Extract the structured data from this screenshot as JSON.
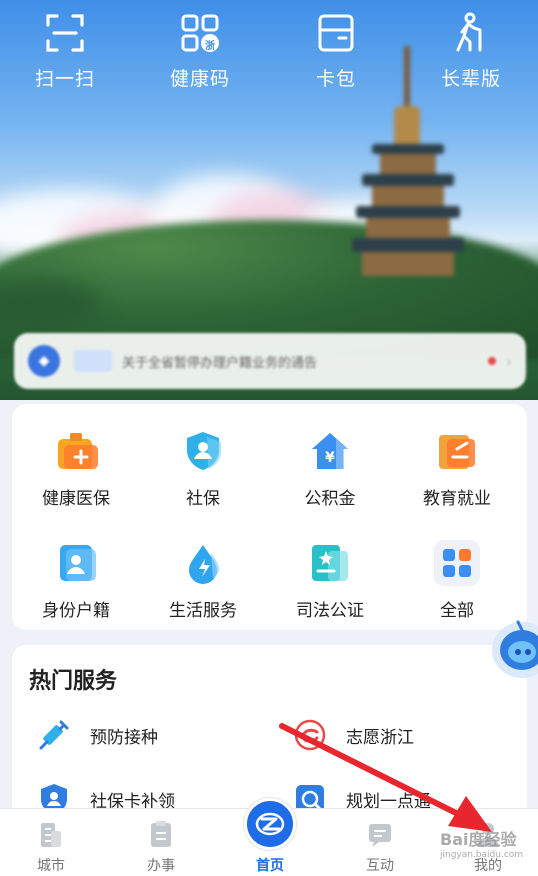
{
  "top_actions": [
    {
      "label": "扫一扫",
      "icon": "scan-icon"
    },
    {
      "label": "健康码",
      "icon": "health-code-icon",
      "badge": "浙"
    },
    {
      "label": "卡包",
      "icon": "card-wallet-icon"
    },
    {
      "label": "长辈版",
      "icon": "elder-mode-icon"
    }
  ],
  "notice": {
    "text": "关于全省暂停办理户籍业务的通告"
  },
  "services_grid": [
    {
      "label": "健康医保",
      "icon": "medical-kit-icon"
    },
    {
      "label": "社保",
      "icon": "social-security-icon"
    },
    {
      "label": "公积金",
      "icon": "housing-fund-icon"
    },
    {
      "label": "教育就业",
      "icon": "education-icon"
    },
    {
      "label": "身份户籍",
      "icon": "id-card-icon"
    },
    {
      "label": "生活服务",
      "icon": "water-drop-icon"
    },
    {
      "label": "司法公证",
      "icon": "notary-icon"
    },
    {
      "label": "全部",
      "icon": "all-apps-icon"
    }
  ],
  "hot_services": {
    "title": "热门服务",
    "items": [
      {
        "label": "预防接种",
        "icon": "syringe-icon"
      },
      {
        "label": "志愿浙江",
        "icon": "volunteer-icon"
      },
      {
        "label": "社保卡补领",
        "icon": "card-reissue-icon"
      },
      {
        "label": "规划一点通",
        "icon": "planning-icon"
      }
    ]
  },
  "bottom_nav": [
    {
      "label": "城市",
      "icon": "city-icon"
    },
    {
      "label": "办事",
      "icon": "tasks-icon"
    },
    {
      "label": "首页",
      "icon": "home-logo-icon",
      "active": true
    },
    {
      "label": "互动",
      "icon": "chat-icon"
    },
    {
      "label": "我的",
      "icon": "profile-icon"
    }
  ],
  "watermark": {
    "text": "Bai度经验",
    "sub": "jingyan.baidu.com"
  },
  "colors": {
    "accent": "#1f6ce8",
    "annotation": "#e8262d"
  }
}
